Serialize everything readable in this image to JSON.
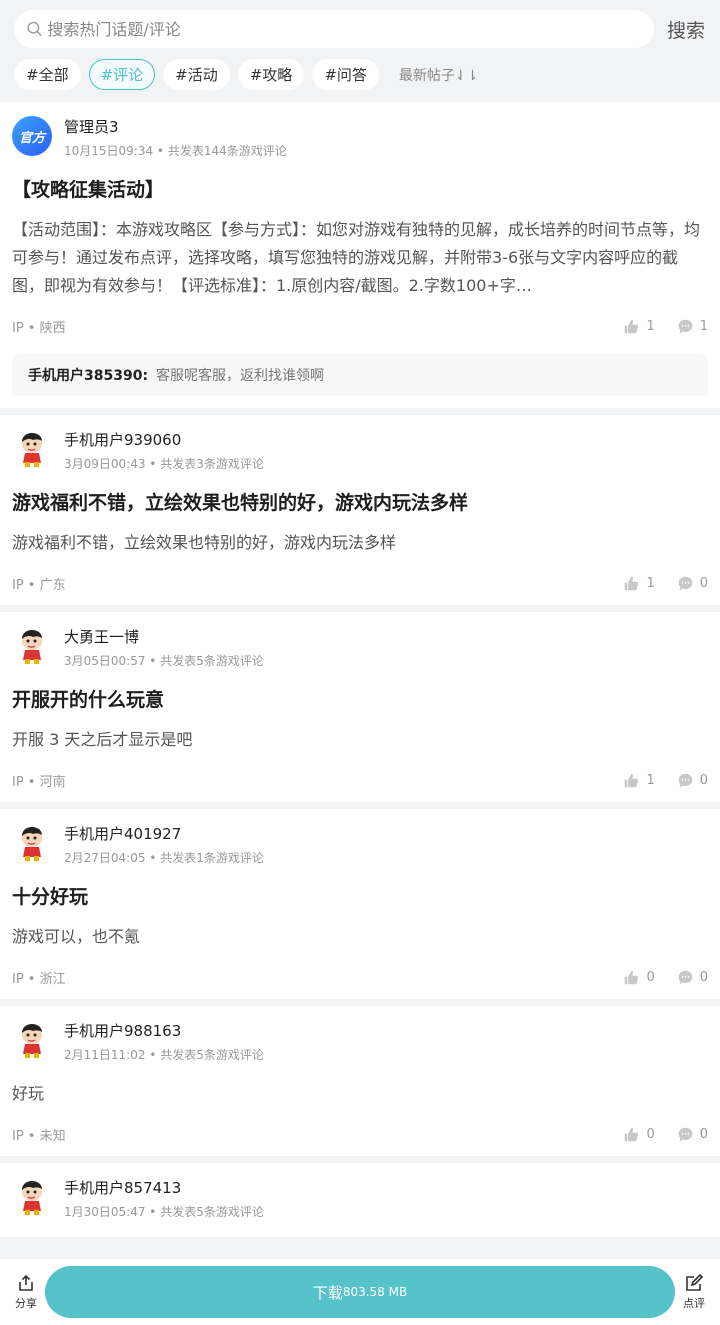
{
  "search": {
    "placeholder": "搜索热门话题/评论",
    "button": "搜索"
  },
  "tags": [
    "#全部",
    "#评论",
    "#活动",
    "#攻略",
    "#问答"
  ],
  "active_tag_index": 1,
  "sort_label": "最新帖子⇃⇂",
  "posts": [
    {
      "avatar_type": "official",
      "avatar_text": "官方",
      "user": "管理员3",
      "meta": "10月15日09:34 • 共发表144条游戏评论",
      "title": "【攻略征集活动】",
      "body": "【活动范围】：本游戏攻略区【参与方式】：如您对游戏有独特的见解，成长培养的时间节点等，均可参与！通过发布点评，选择攻略，填写您独特的游戏见解，并附带3-6张与文字内容呼应的截图，即视为有效参与！【评选标准】：1.原创内容/截图。2.字数100+字…",
      "ip": "IP • 陕西",
      "likes": "1",
      "comments": "1",
      "reply": {
        "user": "手机用户385390:",
        "text": "客服呢客服，返利找谁领啊"
      }
    },
    {
      "avatar_type": "character",
      "user": "手机用户939060",
      "meta": "3月09日00:43 • 共发表3条游戏评论",
      "title": "游戏福利不错，立绘效果也特别的好，游戏内玩法多样",
      "body": "游戏福利不错，立绘效果也特别的好，游戏内玩法多样",
      "ip": "IP • 广东",
      "likes": "1",
      "comments": "0"
    },
    {
      "avatar_type": "character",
      "user": "大勇王一博",
      "meta": "3月05日00:57 • 共发表5条游戏评论",
      "title": "开服开的什么玩意",
      "body": "开服 3 天之后才显示是吧",
      "ip": "IP • 河南",
      "likes": "1",
      "comments": "0"
    },
    {
      "avatar_type": "character",
      "user": "手机用户401927",
      "meta": "2月27日04:05 • 共发表1条游戏评论",
      "title": "十分好玩",
      "body": "游戏可以，也不氪",
      "ip": "IP • 浙江",
      "likes": "0",
      "comments": "0"
    },
    {
      "avatar_type": "character",
      "user": "手机用户988163",
      "meta": "2月11日11:02 • 共发表5条游戏评论",
      "title": "",
      "body": "好玩",
      "ip": "IP • 未知",
      "likes": "0",
      "comments": "0"
    },
    {
      "avatar_type": "character",
      "user": "手机用户857413",
      "meta": "1月30日05:47 • 共发表5条游戏评论",
      "title": "",
      "body": "",
      "ip": "",
      "likes": "",
      "comments": ""
    }
  ],
  "bottom_bar": {
    "share_label": "分享",
    "download_label": "下载",
    "download_size": "803.58 MB",
    "review_label": "点评"
  },
  "colors": {
    "accent": "#56c3cb",
    "tag_active": "#4ec0c8",
    "background": "#f2f3f5"
  }
}
